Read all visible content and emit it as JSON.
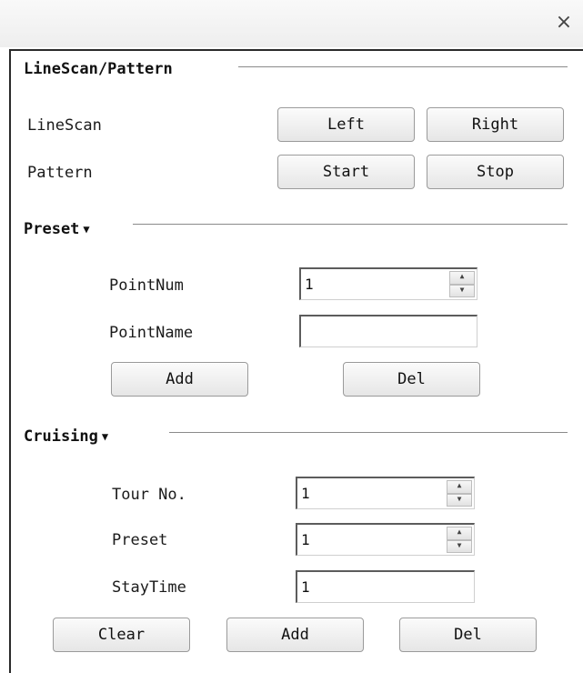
{
  "window": {
    "close_glyph": "×"
  },
  "linescan_pattern": {
    "title": "LineScan/Pattern",
    "linescan_label": "LineScan",
    "left_label": "Left",
    "right_label": "Right",
    "pattern_label": "Pattern",
    "start_label": "Start",
    "stop_label": "Stop"
  },
  "preset": {
    "title": "Preset",
    "caret": "▼",
    "pointnum_label": "PointNum",
    "pointnum_value": "1",
    "pointname_label": "PointName",
    "pointname_value": "",
    "add_label": "Add",
    "del_label": "Del"
  },
  "cruising": {
    "title": "Cruising",
    "caret": "▼",
    "tour_label": "Tour No.",
    "tour_value": "1",
    "preset_label": "Preset",
    "preset_value": "1",
    "staytime_label": "StayTime",
    "staytime_value": "1",
    "clear_label": "Clear",
    "add_label": "Add",
    "del_label": "Del"
  },
  "icons": {
    "close": "close-icon",
    "spin_up": "spin-up-icon",
    "spin_down": "spin-down-icon",
    "caret": "caret-down-icon"
  }
}
